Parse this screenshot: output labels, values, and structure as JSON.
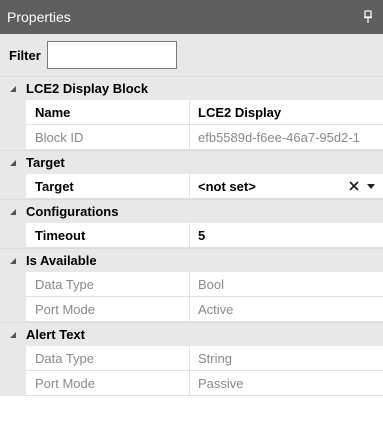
{
  "panel": {
    "title": "Properties"
  },
  "filter": {
    "label": "Filter",
    "value": "",
    "placeholder": ""
  },
  "categories": [
    {
      "label": "LCE2 Display Block",
      "rows": [
        {
          "name": "Name",
          "value": "LCE2 Display",
          "state": "active"
        },
        {
          "name": "Block ID",
          "value": "efb5589d-f6ee-46a7-95d2-1",
          "state": "inactive"
        }
      ]
    },
    {
      "label": "Target",
      "rows": [
        {
          "name": "Target",
          "value": "<not set>",
          "state": "active"
        }
      ]
    },
    {
      "label": "Configurations",
      "rows": [
        {
          "name": "Timeout",
          "value": "5",
          "state": "active"
        }
      ]
    },
    {
      "label": "Is Available",
      "rows": [
        {
          "name": "Data Type",
          "value": "Bool",
          "state": "inactive"
        },
        {
          "name": "Port Mode",
          "value": "Active",
          "state": "inactive"
        }
      ]
    },
    {
      "label": "Alert Text",
      "rows": [
        {
          "name": "Data Type",
          "value": "String",
          "state": "inactive"
        },
        {
          "name": "Port Mode",
          "value": "Passive",
          "state": "inactive"
        }
      ]
    }
  ],
  "icons": {
    "pin": "pin-icon",
    "collapse": "collapse-arrow-icon",
    "clear": "clear-icon",
    "dropdown": "dropdown-icon"
  },
  "colors": {
    "titlebar": "#5f5f5f",
    "category_bg": "#e8e8e8",
    "inactive_text": "#8a8a8a"
  }
}
